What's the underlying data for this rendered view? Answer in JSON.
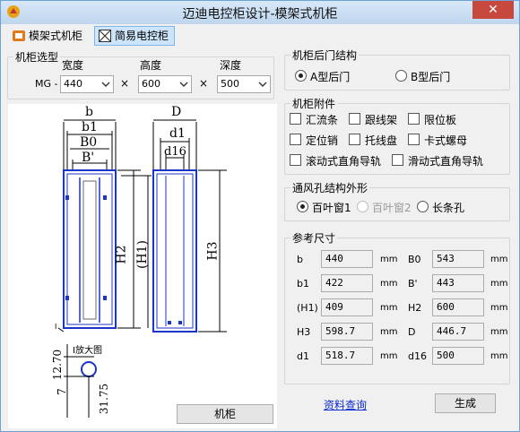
{
  "window": {
    "title": "迈迪电控柜设计-模架式机柜"
  },
  "toolbar": {
    "tab_frame": "模架式机柜",
    "tab_simple": "简易电控柜"
  },
  "selection": {
    "group_label": "机柜选型",
    "prefix": "MG -",
    "width_label": "宽度",
    "height_label": "高度",
    "depth_label": "深度",
    "width_value": "440",
    "height_value": "600",
    "depth_value": "500",
    "times": "×"
  },
  "drawing": {
    "front": {
      "b": "b",
      "b1": "b1",
      "b0": "B0",
      "bp": "B'",
      "h2": "H2",
      "h1": "(H1)"
    },
    "side": {
      "d": "D",
      "d1": "d1",
      "d16": "d16",
      "h3": "H3"
    },
    "detail": {
      "label": "I放大图",
      "dim1": "12.70",
      "dim2": "7",
      "dim3": "31.75",
      "mark": "I"
    }
  },
  "cabinet_button": "机柜",
  "rear_door": {
    "group_label": "机柜后门结构",
    "opt_a": "A型后门",
    "opt_b": "B型后门",
    "selected": "A"
  },
  "accessories": {
    "group_label": "机柜附件",
    "items": [
      "汇流条",
      "跟线架",
      "限位板",
      "定位销",
      "托线盘",
      "卡式螺母",
      "滚动式直角导轨",
      "滑动式直角导轨"
    ]
  },
  "vent": {
    "group_label": "通风孔结构外形",
    "opt1": "百叶窗1",
    "opt2": "百叶窗2",
    "opt3": "长条孔",
    "selected": "1"
  },
  "dims": {
    "group_label": "参考尺寸",
    "unit": "mm",
    "rows": [
      {
        "l_label": "b",
        "l_value": "440",
        "r_label": "B0",
        "r_value": "543"
      },
      {
        "l_label": "b1",
        "l_value": "422",
        "r_label": "B'",
        "r_value": "443"
      },
      {
        "l_label": "(H1)",
        "l_value": "409",
        "r_label": "H2",
        "r_value": "600"
      },
      {
        "l_label": "H3",
        "l_value": "598.7",
        "r_label": "D",
        "r_value": "446.7"
      },
      {
        "l_label": "d1",
        "l_value": "518.7",
        "r_label": "d16",
        "r_value": "500"
      }
    ]
  },
  "footer": {
    "query_link": "资料查询",
    "generate_button": "生成"
  },
  "colors": {
    "accent": "#1a35c8",
    "titlebar": "#c7dcf1",
    "close": "#c7483c"
  }
}
